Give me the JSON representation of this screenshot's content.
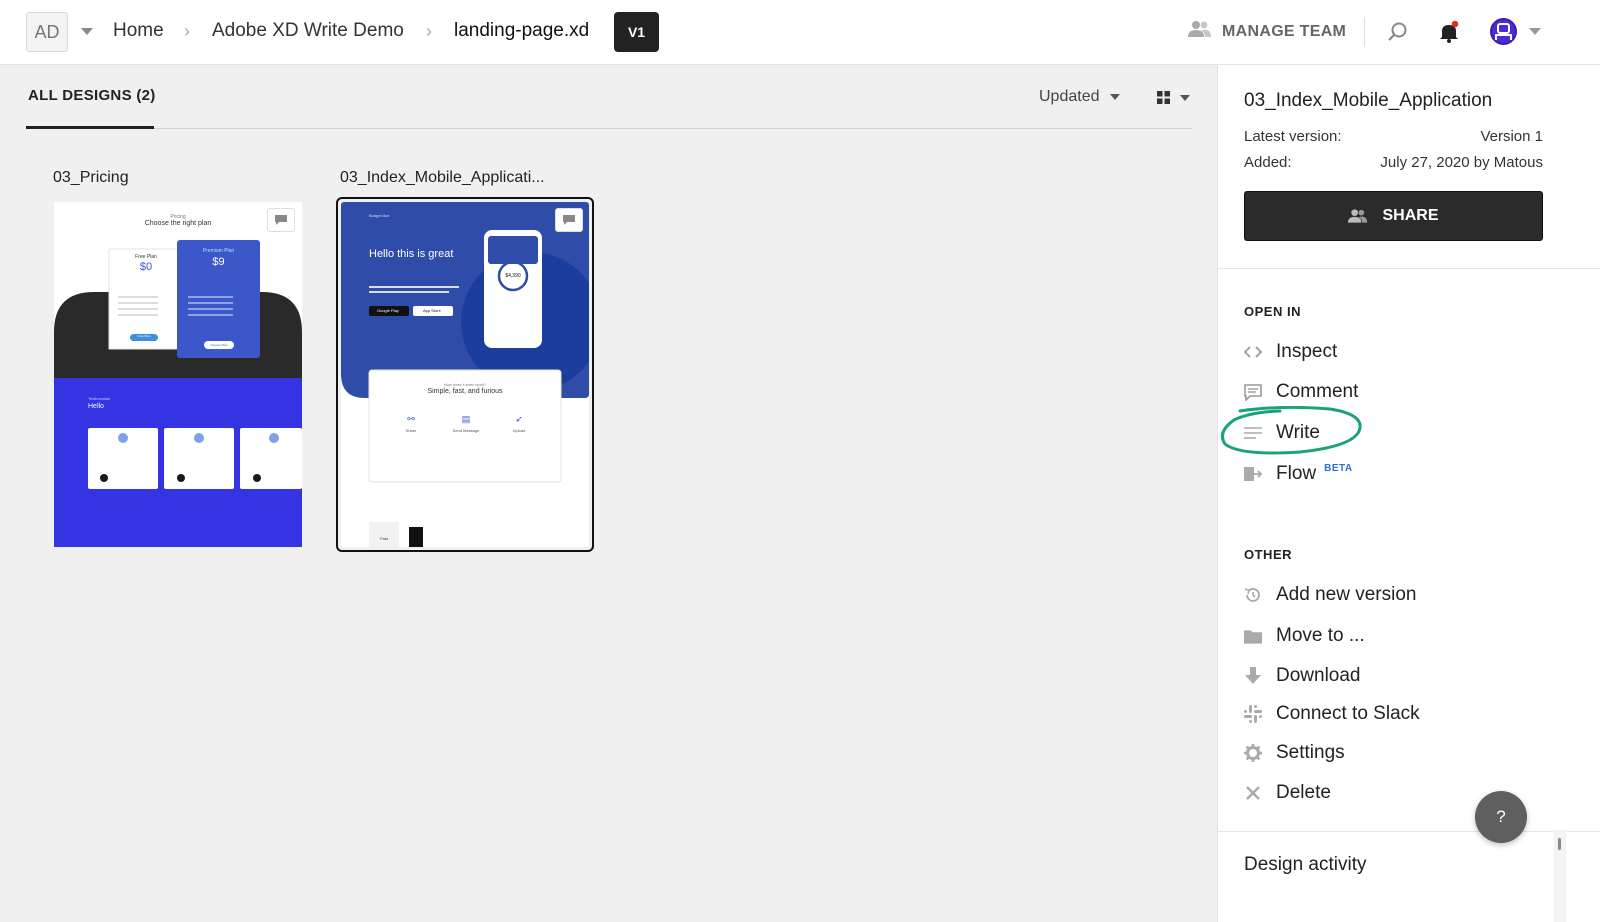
{
  "topbar": {
    "workspace_initials": "AD",
    "breadcrumbs": [
      "Home",
      "Adobe XD Write Demo",
      "landing-page.xd"
    ],
    "version_badge": "V1",
    "manage_team_label": "MANAGE TEAM",
    "notification_dot_color": "#e8291c",
    "avatar_color": "#4b2bd6"
  },
  "main": {
    "tab_label": "ALL DESIGNS (2)",
    "sort_label": "Updated",
    "view_mode_icon": "grid-icon",
    "designs": [
      {
        "title": "03_Pricing",
        "thumb": {
          "heading_small": "Pricing",
          "heading": "Choose the right plan",
          "free_plan": "Free Plan",
          "free_price": "$0",
          "premium_plan": "Premium Plan",
          "premium_price": "$9",
          "free_cta": "Free Plan",
          "premium_cta": "Choose Plan",
          "testimonials_small": "Testimonials",
          "testimonials_heading": "Hello"
        }
      },
      {
        "title": "03_Index_Mobile_Applicati...",
        "thumb": {
          "brand": "Budget Ace",
          "headline": "Hello this is great",
          "google_play": "Google Play",
          "app_store": "App Store",
          "balance": "$4,390",
          "card_small": "How does it even work?",
          "card_heading": "Simple, fast, and furious",
          "feature_1": "Share",
          "feature_2": "Send Message",
          "feature_3": "Upload",
          "bottom_label": "Fast"
        }
      }
    ]
  },
  "panel": {
    "title": "03_Index_Mobile_Application",
    "latest_version_label": "Latest version:",
    "latest_version_value": "Version 1",
    "added_label": "Added:",
    "added_value": "July 27, 2020 by Matous",
    "share_label": "SHARE",
    "open_in_heading": "OPEN IN",
    "open_in_items": [
      {
        "label": "Inspect",
        "icon": "code-icon"
      },
      {
        "label": "Comment",
        "icon": "comment-icon"
      },
      {
        "label": "Write",
        "icon": "lines-icon"
      },
      {
        "label": "Flow",
        "icon": "flow-icon",
        "badge": "BETA"
      }
    ],
    "other_heading": "OTHER",
    "other_items": [
      {
        "label": "Add new version",
        "icon": "history-icon"
      },
      {
        "label": "Move to ...",
        "icon": "folder-icon"
      },
      {
        "label": "Download",
        "icon": "download-icon"
      },
      {
        "label": "Connect to Slack",
        "icon": "slack-icon"
      },
      {
        "label": "Settings",
        "icon": "gear-icon"
      },
      {
        "label": "Delete",
        "icon": "close-icon"
      }
    ],
    "design_activity_label": "Design activity",
    "help_label": "?",
    "highlight_color": "#1aa37a"
  }
}
